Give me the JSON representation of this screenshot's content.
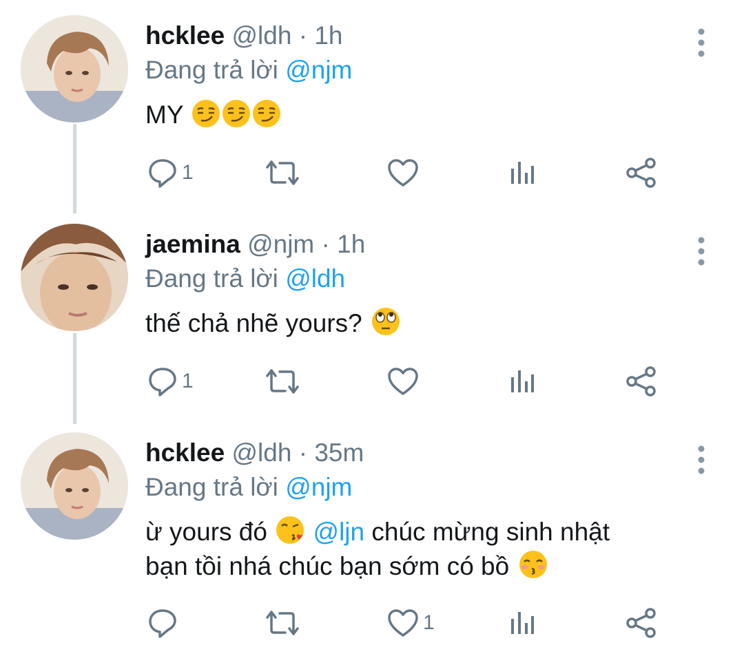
{
  "reply_prefix": "Đang trả lời",
  "separator": "·",
  "tweets": [
    {
      "name": "hcklee",
      "handle": "@ldh",
      "time": "1h",
      "reply_to": "@njm",
      "text_before": "MY",
      "emojis": [
        "smirking-face",
        "smirking-face",
        "smirking-face"
      ],
      "reply_count": "1",
      "like_count": ""
    },
    {
      "name": "jaemina",
      "handle": "@njm",
      "time": "1h",
      "reply_to": "@ldh",
      "text_before": "thế chả nhẽ yours?",
      "emojis": [
        "face-with-rolling-eyes"
      ],
      "reply_count": "1",
      "like_count": ""
    },
    {
      "name": "hcklee",
      "handle": "@ldh",
      "time": "35m",
      "reply_to": "@njm",
      "line1_before": "ừ yours đó",
      "line1_mention": "@ljn",
      "line1_after": "chúc mừng sinh nhật",
      "line2": "bạn tồi nhá chúc bạn sớm có bồ",
      "emojis": [
        "face-blowing-a-kiss",
        "kissing-face-with-smiling-eyes"
      ],
      "reply_count": "",
      "like_count": "1"
    }
  ],
  "colors": {
    "mention": "#1da1f2",
    "secondary_text": "#657786",
    "primary_text": "#14171a",
    "thread_line": "#cfd9de"
  }
}
